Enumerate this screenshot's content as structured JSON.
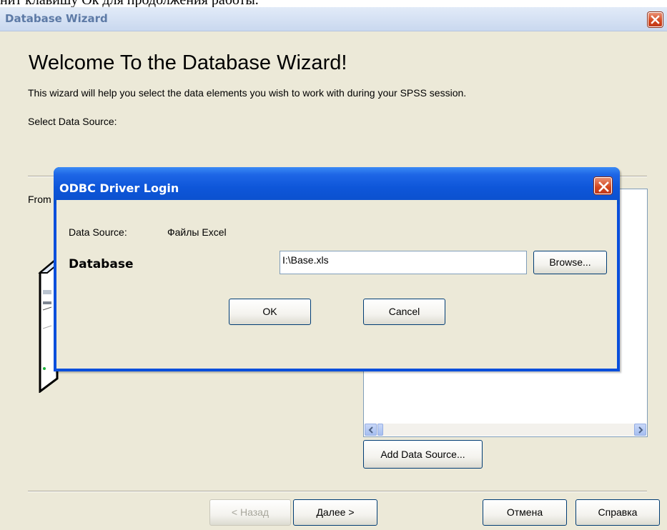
{
  "document": {
    "fragment_text": "нит клавишу Ок для продолжения работы."
  },
  "wizard": {
    "title": "Database Wizard",
    "heading": "Welcome To the Database Wizard!",
    "intro": "This wizard will help you select the data elements you wish to work with during your SPSS session.",
    "select_label": "Select Data Source:",
    "from_label": "From",
    "add_data_source": "Add Data Source...",
    "buttons": {
      "back": "< Назад",
      "next": "Далее >",
      "cancel": "Отмена",
      "help": "Справка"
    }
  },
  "odbc_dialog": {
    "title": "ODBC Driver Login",
    "data_source_label": "Data Source:",
    "data_source_value": "Файлы Excel",
    "database_label": "Database",
    "database_value": "I:\\Base.xls",
    "browse": "Browse...",
    "ok": "OK",
    "cancel": "Cancel"
  },
  "colors": {
    "dialog_title_blue": "#0a4fdc",
    "window_face": "#ece9d8",
    "close_red": "#d2461d"
  },
  "icons": [
    "close-icon",
    "scroll-left-icon",
    "scroll-right-icon",
    "computer-icon"
  ]
}
